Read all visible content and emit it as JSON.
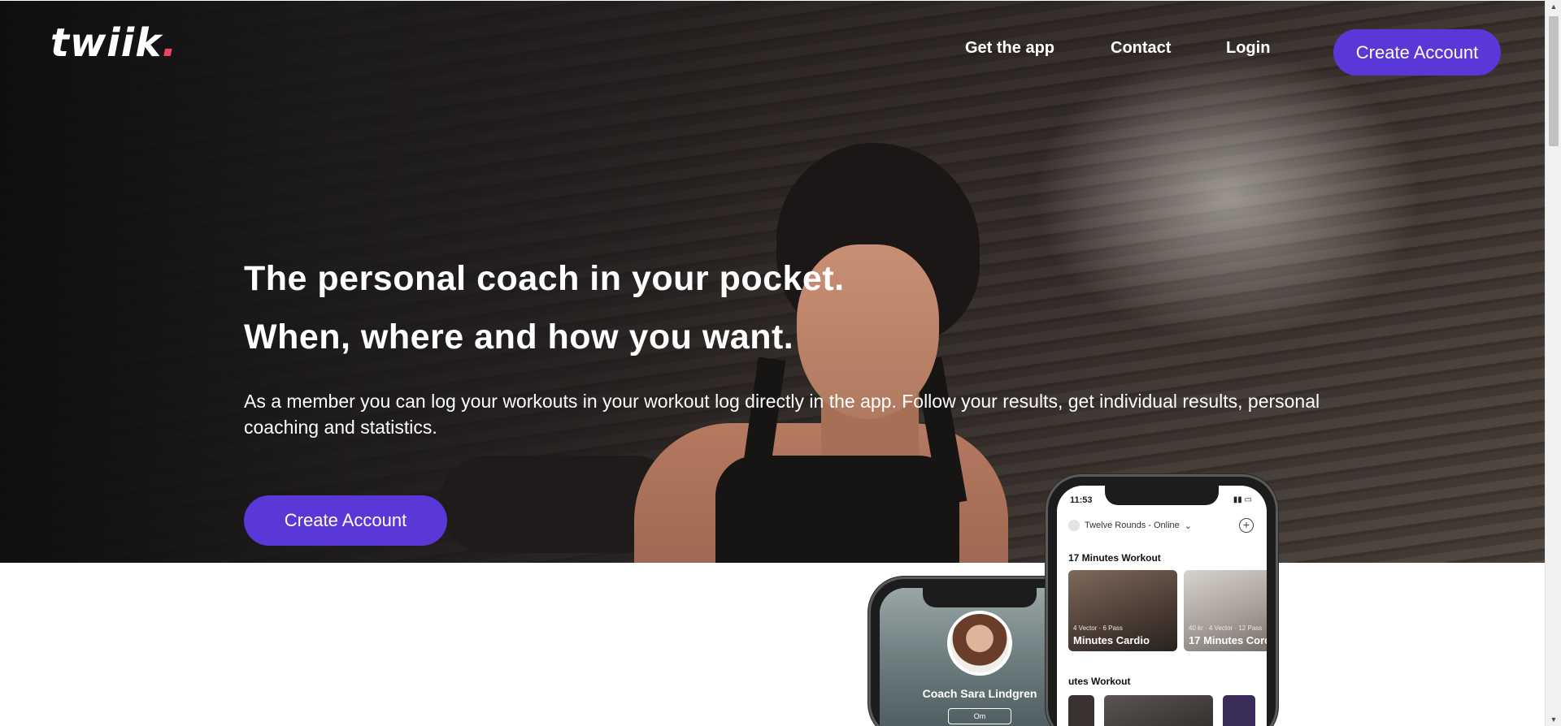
{
  "brand": {
    "name": "twiik",
    "dot": ".",
    "accent": "#e8465f"
  },
  "nav": {
    "links": [
      "Get the app",
      "Contact",
      "Login"
    ],
    "cta": "Create Account",
    "cta_color": "#5a38d8"
  },
  "hero": {
    "headline_1": "The personal coach in your pocket.",
    "headline_2": "When, where and how you want.",
    "body": "As a member you can log your workouts in your workout log directly in the app. Follow your results, get individual results, personal coaching and statistics.",
    "cta": "Create Account"
  },
  "phone_front": {
    "time": "11:53",
    "studio": "Twelve Rounds - Online",
    "section_1": "17 Minutes Workout",
    "cards": [
      {
        "meta": "4 Vector · 6 Pass",
        "title": "Minutes Cardio"
      },
      {
        "meta": "40 kr · 4 Vector · 12 Pass",
        "title": "17 Minutes Core"
      }
    ],
    "section_2": "utes Workout"
  },
  "phone_back": {
    "coach_name": "Coach Sara Lindgren",
    "button": "Om"
  },
  "icons": {
    "chevron": "chevron-down-icon",
    "plus": "plus-circle-icon",
    "scroll_up": "scroll-up-icon",
    "scroll_down": "scroll-down-icon"
  }
}
